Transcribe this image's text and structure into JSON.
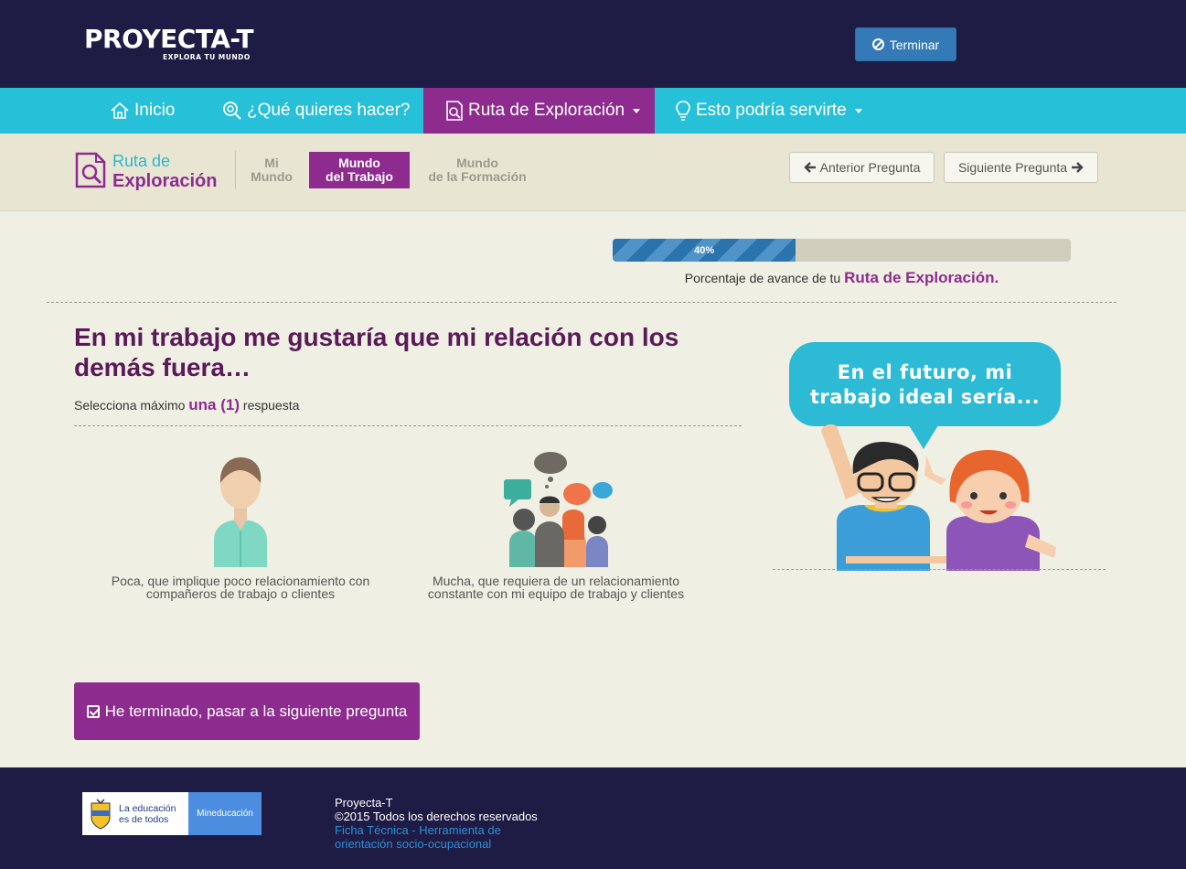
{
  "header": {
    "logo_text": "PROYECTA-T",
    "logo_tagline": "EXPLORA TU MUNDO",
    "terminar_label": "Terminar"
  },
  "nav": {
    "items": [
      {
        "label": "Inicio",
        "icon": "home-icon"
      },
      {
        "label": "¿Qué quieres hacer?",
        "icon": "search-icon"
      },
      {
        "label": "Ruta de Exploración",
        "icon": "document-search-icon",
        "active": true
      },
      {
        "label": "Esto podría servirte",
        "icon": "lightbulb-icon"
      }
    ]
  },
  "subheader": {
    "title_line1": "Ruta de",
    "title_line2": "Exploración",
    "steps": [
      {
        "line1": "Mi",
        "line2": "Mundo"
      },
      {
        "line1": "Mundo",
        "line2": "del Trabajo",
        "active": true
      },
      {
        "line1": "Mundo",
        "line2": "de la Formación"
      }
    ],
    "prev_label": "Anterior Pregunta",
    "next_label": "Siguiente Pregunta"
  },
  "progress": {
    "value": 40,
    "label": "40%",
    "caption_prefix": "Porcentaje de avance de tu",
    "caption_strong": "Ruta de Exploración."
  },
  "question": {
    "text": "En mi trabajo me gustaría que mi relación con los demás fuera…",
    "instruction_prefix": "Selecciona máximo",
    "instruction_strong": "una (1)",
    "instruction_suffix": "respuesta"
  },
  "options": [
    {
      "label": "Poca, que implique poco relacionamiento con compañeros de trabajo o clientes"
    },
    {
      "label": "Mucha, que requiera de un relacionamiento constante con mi equipo de trabajo y clientes"
    }
  ],
  "illustration": {
    "bubble_line1": "En el futuro, mi",
    "bubble_line2": "trabajo ideal sería..."
  },
  "cta": {
    "label": "He terminado, pasar a la siguiente pregunta"
  },
  "footer": {
    "logo_left_line1": "La educación",
    "logo_left_line2": "es de todos",
    "logo_right": "Mineducación",
    "line1": "Proyecta-T",
    "line2": "©2015 Todos los derechos reservados",
    "link1": "Ficha Técnica - Herramienta de",
    "link2": "orientación socio-ocupacional"
  },
  "colors": {
    "header_bg": "#1e1b45",
    "nav_bg": "#27c0d9",
    "accent_purple": "#8e2b8f",
    "page_bg": "#f0efe3"
  }
}
